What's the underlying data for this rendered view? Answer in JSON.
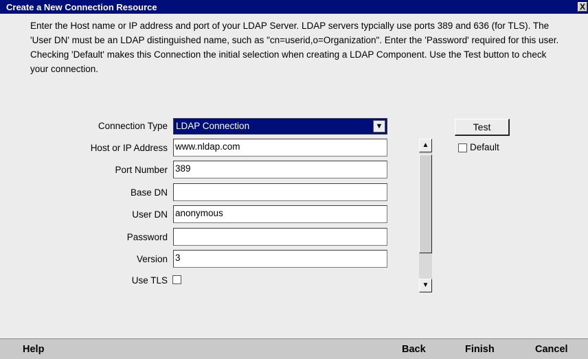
{
  "window": {
    "title": "Create a New Connection Resource",
    "close_label": "X"
  },
  "description": "Enter the Host name or IP address and port of your LDAP Server.  LDAP servers typcially use ports 389 and 636 (for TLS).  The 'User DN' must be an LDAP distinguished name, such as \"cn=userid,o=Organization\". Enter the 'Password' required for this user.  Checking 'Default' makes this Connection the initial selection when creating a LDAP Component.  Use the Test button to check your connection.",
  "form": {
    "connection_type": {
      "label": "Connection Type",
      "value": "LDAP Connection"
    },
    "host": {
      "label": "Host or IP Address",
      "value": "www.nldap.com"
    },
    "port": {
      "label": "Port Number",
      "value": "389"
    },
    "base_dn": {
      "label": "Base DN",
      "value": ""
    },
    "user_dn": {
      "label": "User DN",
      "value": "anonymous"
    },
    "password": {
      "label": "Password",
      "value": ""
    },
    "version": {
      "label": "Version",
      "value": "3"
    },
    "use_tls": {
      "label": "Use TLS",
      "checked": false
    }
  },
  "side": {
    "test_label": "Test",
    "default_label": "Default",
    "default_checked": false
  },
  "footer": {
    "help": "Help",
    "back": "Back",
    "finish": "Finish",
    "cancel": "Cancel"
  },
  "colors": {
    "title_bar": "#000e7a",
    "selection": "#000e7a",
    "background": "#ececec",
    "footer": "#c9c9c9"
  }
}
